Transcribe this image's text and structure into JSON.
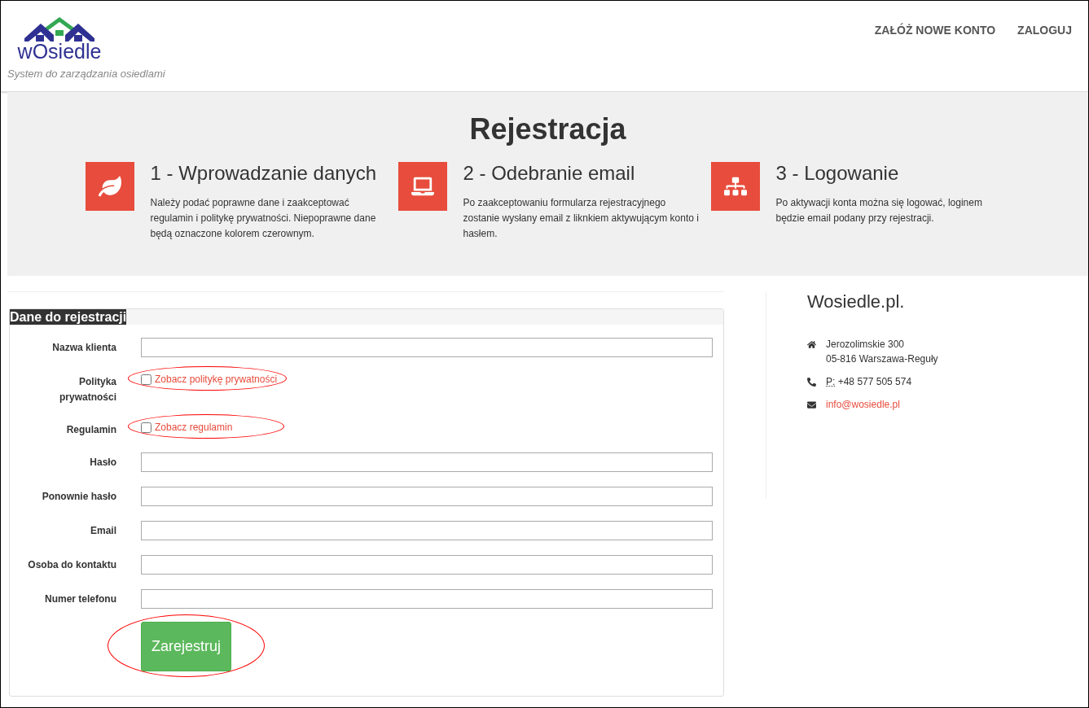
{
  "header": {
    "logo_text": "wOsiedle",
    "tagline": "System do zarządzania osiedlami",
    "nav": [
      {
        "label": "ZAŁÓŻ NOWE KONTO"
      },
      {
        "label": "ZALOGUJ"
      }
    ]
  },
  "hero": {
    "title": "Rejestracja",
    "steps": [
      {
        "kind": "leaf",
        "title": "1 - Wprowadzanie danych",
        "text": "Należy podać poprawne dane i zaakceptować regulamin i politykę prywatności. Niepoprawne dane będą oznaczone kolorem czerownym."
      },
      {
        "kind": "laptop",
        "title": "2 - Odebranie email",
        "text": "Po zaakceptowaniu formularza rejestracyjnego zostanie wysłany email z liknkiem aktywującym konto i hasłem."
      },
      {
        "kind": "sitemap",
        "title": "3 - Logowanie",
        "text": "Po aktywacji konta można się logować, loginem będzie email podany przy rejestracji."
      }
    ]
  },
  "form": {
    "title": "Dane do rejestracji",
    "fields": [
      {
        "kind": "text",
        "label": "Nazwa klienta"
      },
      {
        "kind": "checkbox",
        "label": "Polityka prywatności",
        "link": "Zobacz politykę prywatności",
        "checked": false,
        "circled": true
      },
      {
        "kind": "checkbox",
        "label": "Regulamin",
        "link": "Zobacz regulamin",
        "checked": false,
        "circled": true
      },
      {
        "kind": "text",
        "label": "Hasło"
      },
      {
        "kind": "text",
        "label": "Ponownie hasło"
      },
      {
        "kind": "text",
        "label": "Email"
      },
      {
        "kind": "text",
        "label": "Osoba do kontaktu"
      },
      {
        "kind": "text",
        "label": "Numer telefonu"
      }
    ],
    "submit": {
      "label": "Zarejestruj",
      "circled": true
    }
  },
  "contact": {
    "title": "Wosiedle.pl.",
    "address": [
      "Jerozolimskie 300",
      "05-816 Warszawa-Reguły"
    ],
    "phone_label": "P:",
    "phone": "+48 577 505 574",
    "email": "info@wosiedle.pl"
  }
}
